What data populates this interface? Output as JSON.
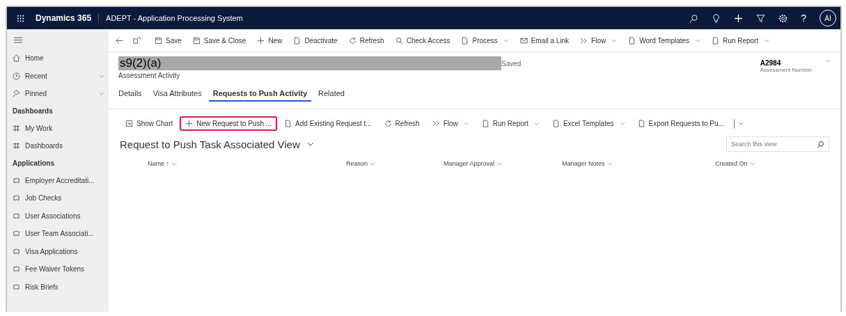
{
  "topbar": {
    "brand": "Dynamics 365",
    "app_title": "ADEPT - Application Processing System",
    "help": "?",
    "avatar": "AI"
  },
  "sidebar": {
    "nav": [
      {
        "label": "Home",
        "kind": "home",
        "chevron": false
      },
      {
        "label": "Recent",
        "kind": "clock",
        "chevron": true
      },
      {
        "label": "Pinned",
        "kind": "pin",
        "chevron": true
      }
    ],
    "sections": [
      {
        "title": "Dashboards",
        "items": [
          {
            "label": "My Work",
            "kind": "grid"
          },
          {
            "label": "Dashboards",
            "kind": "grid"
          }
        ]
      },
      {
        "title": "Applications",
        "items": [
          {
            "label": "Employer Accreditati...",
            "kind": "puzzle"
          },
          {
            "label": "Job Checks",
            "kind": "puzzle"
          },
          {
            "label": "User Associations",
            "kind": "puzzle"
          },
          {
            "label": "User Team Associati...",
            "kind": "puzzle"
          },
          {
            "label": "Visa Applications",
            "kind": "puzzle"
          },
          {
            "label": "Fee Waiver Tokens",
            "kind": "puzzle"
          },
          {
            "label": "Risk Briefs",
            "kind": "puzzle"
          }
        ]
      }
    ]
  },
  "commands": [
    {
      "label": "Save",
      "kind": "save",
      "dropdown": false
    },
    {
      "label": "Save & Close",
      "kind": "save",
      "dropdown": false
    },
    {
      "label": "New",
      "kind": "plus",
      "dropdown": false
    },
    {
      "label": "Deactivate",
      "kind": "doc",
      "dropdown": false
    },
    {
      "label": "Refresh",
      "kind": "refresh",
      "dropdown": false
    },
    {
      "label": "Check Access",
      "kind": "search",
      "dropdown": false
    },
    {
      "label": "Process",
      "kind": "doc",
      "dropdown": true
    },
    {
      "label": "Email a Link",
      "kind": "mail",
      "dropdown": false
    },
    {
      "label": "Flow",
      "kind": "flow",
      "dropdown": true
    },
    {
      "label": "Word Templates",
      "kind": "doc",
      "dropdown": true
    },
    {
      "label": "Run Report",
      "kind": "doc",
      "dropdown": true
    }
  ],
  "record": {
    "redaction_label": "s9(2)(a)",
    "status": "Saved",
    "entity": "Assessment Activity",
    "field_value": "A2984",
    "field_label": "Assessment Number"
  },
  "tabs": [
    {
      "label": "Details",
      "selected": false
    },
    {
      "label": "Visa Attributes",
      "selected": false
    },
    {
      "label": "Requests to Push Activity",
      "selected": true
    },
    {
      "label": "Related",
      "selected": false
    }
  ],
  "subgrid": {
    "commands": [
      {
        "label": "Show Chart",
        "kind": "chart",
        "dropdown": false,
        "highlighted": false
      },
      {
        "label": "New Request to Push ...",
        "kind": "plus",
        "dropdown": false,
        "highlighted": true
      },
      {
        "label": "Add Existing Request t...",
        "kind": "doc",
        "dropdown": false,
        "highlighted": false
      },
      {
        "label": "Refresh",
        "kind": "refresh",
        "dropdown": false,
        "highlighted": false
      },
      {
        "label": "Flow",
        "kind": "flow",
        "dropdown": true,
        "highlighted": false
      },
      {
        "label": "Run Report",
        "kind": "doc",
        "dropdown": true,
        "highlighted": false
      },
      {
        "label": "Excel Templates",
        "kind": "doc",
        "dropdown": true,
        "highlighted": false
      },
      {
        "label": "Export Requests to Pu...",
        "kind": "doc",
        "dropdown": false,
        "highlighted": false
      }
    ],
    "view_title": "Request to Push Task Associated View",
    "search": {
      "placeholder": "Search this view"
    },
    "columns": [
      {
        "label": "Name ↑"
      },
      {
        "label": "Reason"
      },
      {
        "label": "Manager Approval"
      },
      {
        "label": "Manager Notes"
      },
      {
        "label": "Created On"
      }
    ]
  }
}
